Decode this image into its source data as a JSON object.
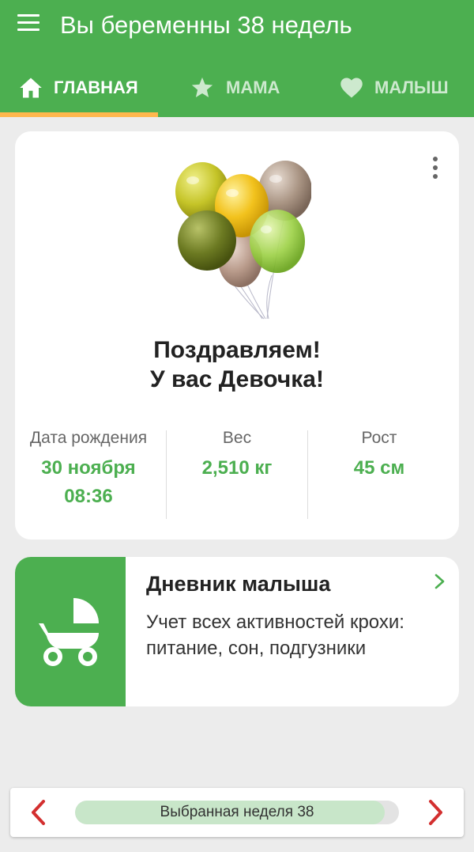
{
  "app_bar": {
    "title": "Вы беременны 38 недель",
    "background_color": "#4caf50",
    "menu_icon": "hamburger-menu-icon"
  },
  "tabs": [
    {
      "label": "ГЛАВНАЯ",
      "icon": "home-icon",
      "active": true
    },
    {
      "label": "МАМА",
      "icon": "star-icon",
      "active": false
    },
    {
      "label": "МАЛЫШ",
      "icon": "heart-icon",
      "active": false
    }
  ],
  "tab_indicator_color": "#ffb74d",
  "birth_card": {
    "image": "balloons-illustration",
    "more_icon": "more-vertical-icon",
    "heading_line1": "Поздравляем!",
    "heading_line2": "У вас Девочка!",
    "stats": [
      {
        "label": "Дата рождения",
        "value_line1": "30 ноября",
        "value_line2": "08:36"
      },
      {
        "label": "Вес",
        "value_line1": "2,510 кг",
        "value_line2": ""
      },
      {
        "label": "Рост",
        "value_line1": "45 см",
        "value_line2": ""
      }
    ],
    "value_color": "#4caf50"
  },
  "diary_card": {
    "icon": "stroller-icon",
    "title": "Дневник малыша",
    "description": "Учет всех активностей крохи: питание, сон, подгузники",
    "chevron_icon": "chevron-right-icon"
  },
  "week_selector": {
    "label": "Выбранная неделя 38",
    "progress_fraction": 0.955,
    "prev_icon": "chevron-left-icon",
    "next_icon": "chevron-right-icon",
    "arrow_color": "#d32f2f"
  }
}
